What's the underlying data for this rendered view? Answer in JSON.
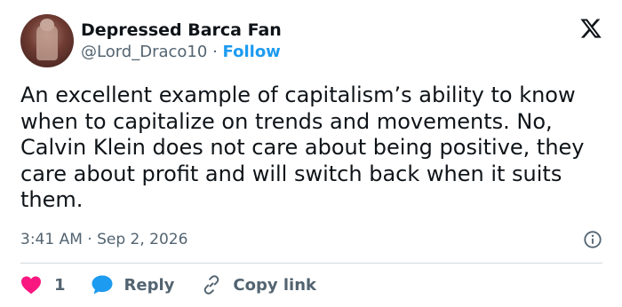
{
  "author": {
    "display_name": "Depressed Barca Fan",
    "handle": "@Lord_Draco10",
    "separator": "·",
    "follow_label": "Follow"
  },
  "tweet": {
    "text": "An excellent example of capitalism’s ability to know when to capitalize on trends and movements. No, Calvin Klein does not care about being positive, they care about profit and will switch back when it suits them.",
    "time": "3:41 AM",
    "date_separator": "·",
    "date": "Sep 2, 2026"
  },
  "actions": {
    "like_count": "1",
    "reply_label": "Reply",
    "copy_link_label": "Copy link"
  },
  "colors": {
    "accent": "#1d9bf0",
    "like": "#f91880",
    "secondary_text": "#536471",
    "divider": "#cfd9de"
  },
  "icons": {
    "brand": "x-logo-icon",
    "info": "info-icon",
    "like": "heart-icon",
    "reply": "speech-bubble-icon",
    "copy_link": "link-icon"
  }
}
